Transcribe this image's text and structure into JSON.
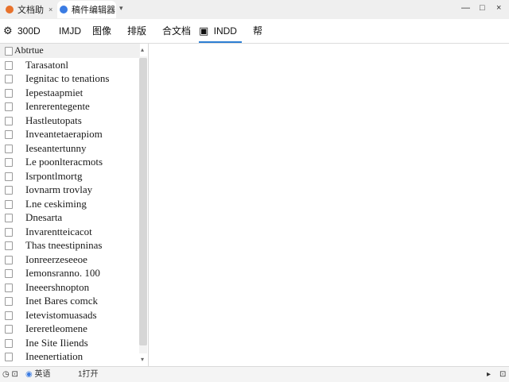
{
  "tabs": [
    {
      "label": "文档助",
      "color": "#e8722c"
    },
    {
      "label": "稿件编辑器",
      "color": "#3b7ce3"
    }
  ],
  "tab_close": "×",
  "tab_new": "▾",
  "window_controls": {
    "minimize": "—",
    "maximize": "□",
    "close": "×"
  },
  "toolbar": {
    "items": [
      {
        "icon": "gear-icon",
        "glyph": "⚙",
        "label": "300D"
      },
      {
        "label": "IMJD"
      },
      {
        "label": "图像"
      },
      {
        "label": "排版"
      },
      {
        "label": "合文档"
      },
      {
        "icon": "camera-icon",
        "glyph": "▣",
        "label": "INDD",
        "active": true
      },
      {
        "label": "帮"
      }
    ],
    "accent": "#2d7fd3"
  },
  "sidebar": {
    "header": "Abtrtue",
    "items": [
      "Tarasatonl",
      "Iegnitac to tenations",
      "Iepestaapmiet",
      "Ienrerentegente",
      "Hastleutopats",
      "Inveantetaerapiom",
      "Ieseantertunny",
      "Le poonlteracmots",
      "Isrpontlmortg",
      "Iovnarm trovlay",
      "Lne ceskiming",
      "Dnesarta",
      "Invarentteicacot",
      "Thas tneestipninas",
      "Ionreerzeseeoe",
      "Iemonsranno. 100",
      "Ineeershnopton",
      "Inet Bares comck",
      "Ietevistomuasads",
      "Iereretleomene",
      "Ine Site Iliends",
      "Ineenertiation"
    ]
  },
  "statusbar": {
    "left_icon": "clock-icon",
    "lang_icon": "globe-icon",
    "lang": "英语",
    "mode": "1打开",
    "arrow": "▸",
    "zoom_icon": "zoom-icon"
  }
}
